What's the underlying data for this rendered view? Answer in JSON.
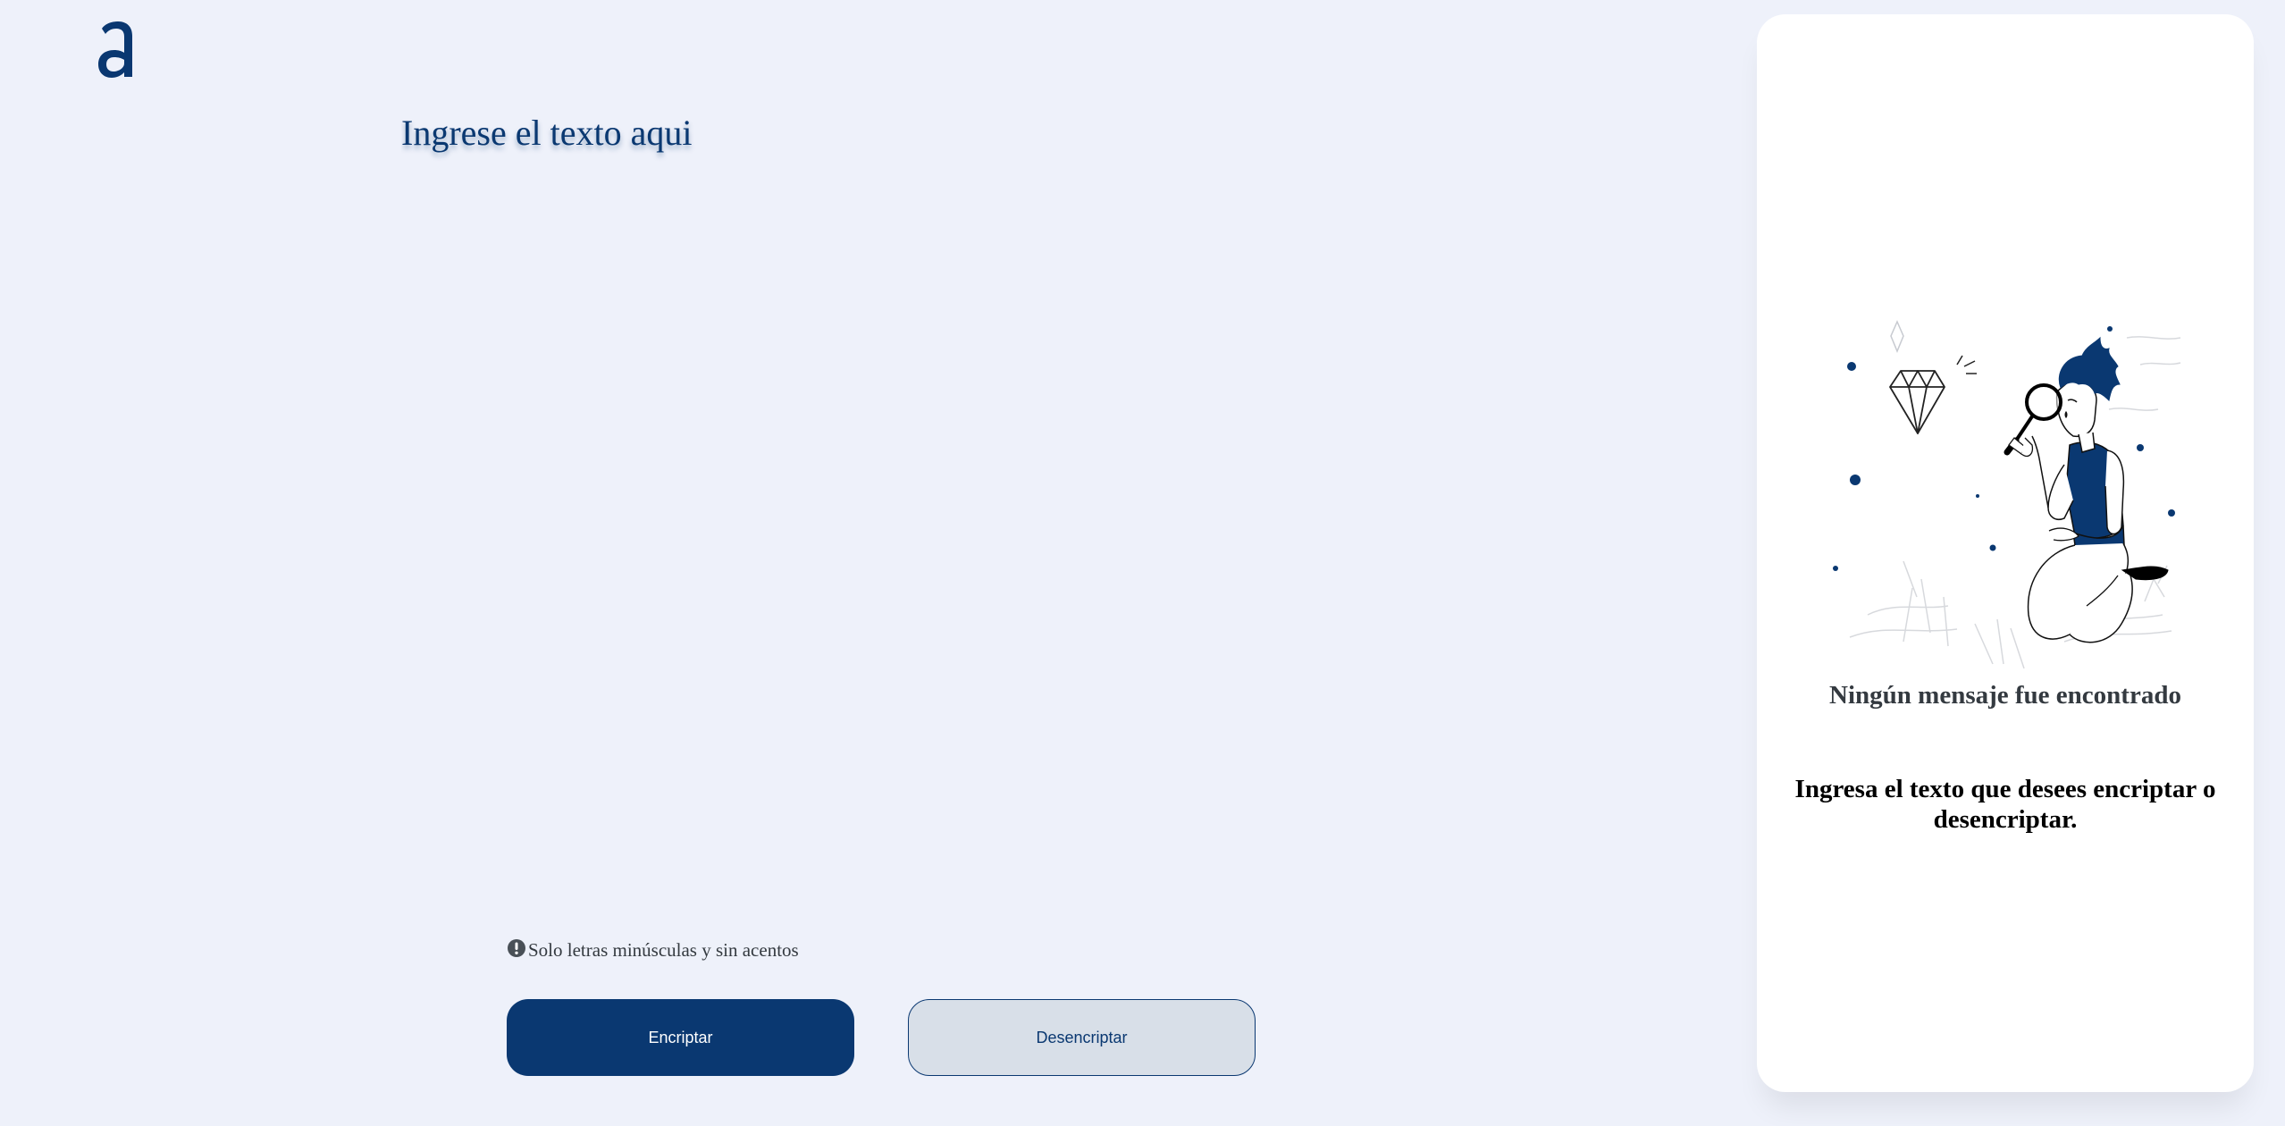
{
  "logo": {
    "icon": "alura-a-logo-icon",
    "color": "#0a3871"
  },
  "input": {
    "placeholder": "Ingrese el texto aqui",
    "value": ""
  },
  "hint": {
    "icon": "exclamation-circle-icon",
    "text": "Solo letras minúsculas y sin acentos"
  },
  "buttons": {
    "encrypt_label": "Encriptar",
    "decrypt_label": "Desencriptar"
  },
  "output_panel": {
    "illustration": "searching-man-illustration",
    "title": "Ningún mensaje fue encontrado",
    "text": "Ingresa el texto que desees encriptar o desencriptar."
  },
  "colors": {
    "background": "#eef1fa",
    "accent": "#0a3871",
    "secondary_button": "#d8dfe8",
    "panel": "#ffffff"
  }
}
